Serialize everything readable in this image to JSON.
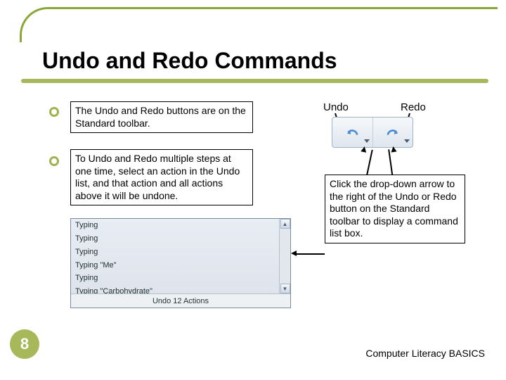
{
  "slide": {
    "title": "Undo and Redo Commands",
    "page_number": "8",
    "footer": "Computer Literacy BASICS"
  },
  "bullets": {
    "b1": "The Undo and Redo buttons are on the Standard toolbar.",
    "b2": "To Undo and Redo multiple steps at one time, select an action in the Undo list, and that action and all actions above it will be undone."
  },
  "labels": {
    "undo": "Undo",
    "redo": "Redo"
  },
  "callout": {
    "dropdown": "Click the drop-down arrow to the right of the Undo or Redo button on the Standard toolbar to display a command list box."
  },
  "undo_list": {
    "items": [
      "Typing",
      "Typing",
      "Typing",
      "Typing \"Me\"",
      "Typing",
      "Typing \"Carbohydrate\""
    ],
    "status": "Undo 12 Actions"
  }
}
